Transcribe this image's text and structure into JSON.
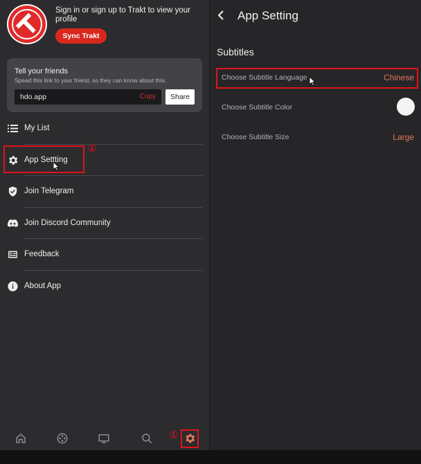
{
  "sidebar": {
    "signin_text": "Sign in or sign up to Trakt to view your profile",
    "sync_label": "Sync Trakt",
    "share": {
      "title": "Tell your friends",
      "subtitle": "Spead this link to your friend, so they can know about this.",
      "link": "hdo.app",
      "copy_label": "Copy",
      "share_label": "Share"
    },
    "menu": [
      {
        "label": "My List",
        "icon": "list-icon"
      },
      {
        "label": "App Settting",
        "icon": "gear-icon"
      },
      {
        "label": "Join Telegram",
        "icon": "shield-check-icon"
      },
      {
        "label": "Join Discord Community",
        "icon": "discord-icon"
      },
      {
        "label": "Feedback",
        "icon": "feedback-icon"
      },
      {
        "label": "About App",
        "icon": "info-icon"
      }
    ],
    "markers": {
      "step1": "①",
      "step2": "②"
    },
    "bottom_nav": [
      "home-icon",
      "film-reel-icon",
      "tv-icon",
      "search-icon",
      "gear-icon"
    ]
  },
  "settings": {
    "title": "App Setting",
    "section": "Subtitles",
    "rows": [
      {
        "label": "Choose Subtitle Language",
        "value": "Chinese"
      },
      {
        "label": "Choose Subtitle Color",
        "value": ""
      },
      {
        "label": "Choose Subtitle Size",
        "value": "Large"
      }
    ]
  },
  "colors": {
    "accent_red": "#d8281e",
    "highlight": "#e0141a",
    "value_orange": "#e07a5a",
    "panel_bg": "#2c2b2e",
    "card_bg": "#434247"
  }
}
